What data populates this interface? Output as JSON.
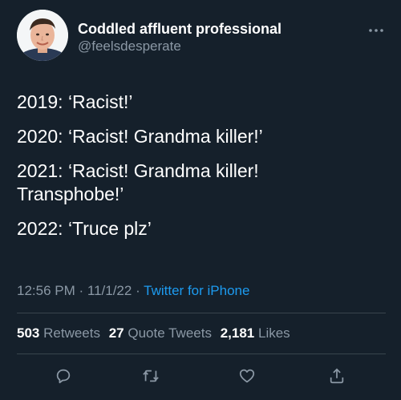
{
  "user": {
    "display_name": "Coddled affluent professional",
    "handle": "@feelsdesperate"
  },
  "tweet": {
    "lines": [
      "2019: ‘Racist!’",
      "2020: ‘Racist! Grandma killer!’",
      "2021: ‘Racist! Grandma killer!",
      "Transphobe!’",
      "2022: ‘Truce plz’"
    ],
    "time": "12:56 PM",
    "sep1": " · ",
    "date": "11/1/22",
    "sep2": " · ",
    "source": "Twitter for iPhone"
  },
  "stats": {
    "retweets_count": "503",
    "retweets_label": "Retweets",
    "quotes_count": "27",
    "quotes_label": "Quote Tweets",
    "likes_count": "2,181",
    "likes_label": "Likes"
  },
  "icons": {
    "more": "more-dots-icon",
    "reply": "reply-icon",
    "retweet": "retweet-icon",
    "like": "heart-icon",
    "share": "share-icon"
  },
  "colors": {
    "background": "#15202b",
    "secondary_text": "#8b98a5",
    "accent": "#1d9bf0",
    "divider": "#38444d"
  }
}
